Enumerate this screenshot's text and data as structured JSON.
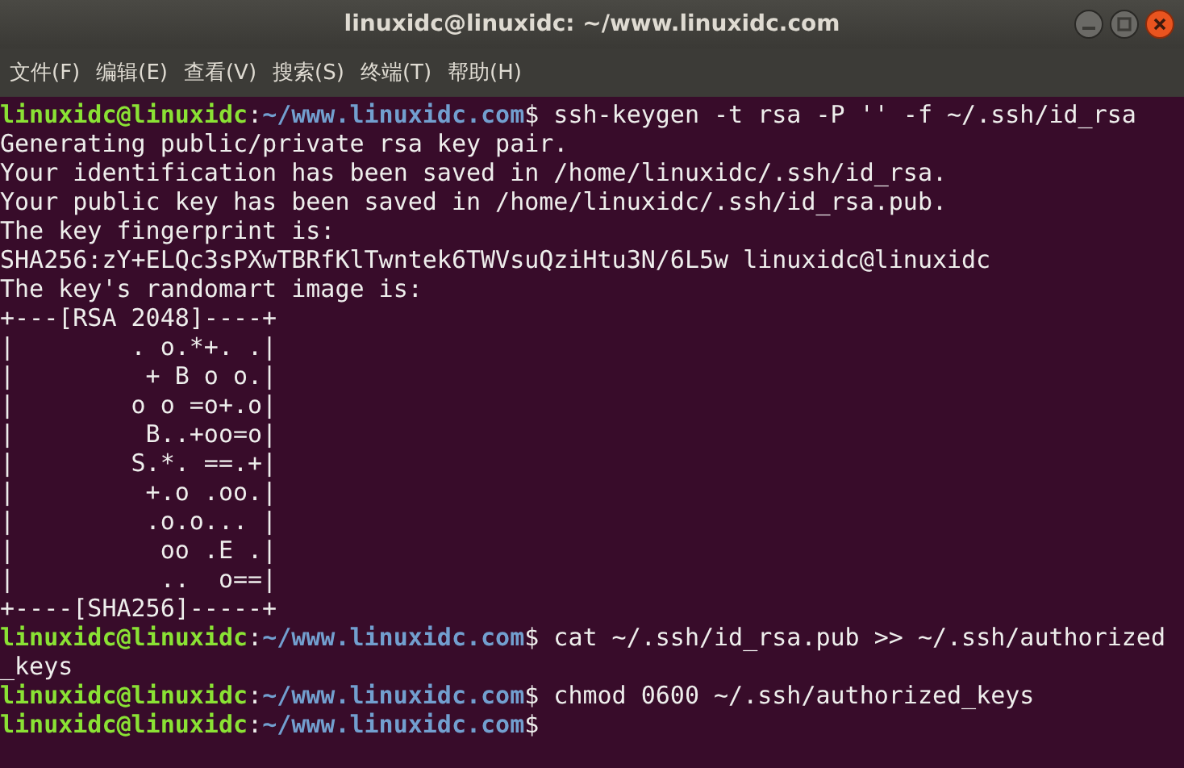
{
  "window": {
    "title": "linuxidc@linuxidc: ~/www.linuxidc.com"
  },
  "menu": [
    "文件(F)",
    "编辑(E)",
    "查看(V)",
    "搜索(S)",
    "终端(T)",
    "帮助(H)"
  ],
  "terminal": {
    "lines": [
      {
        "kind": "prompt",
        "user": "linuxidc@linuxidc",
        "separator": ":",
        "path": "~/www.linuxidc.com",
        "symbol": "$",
        "command": " ssh-keygen -t rsa -P '' -f ~/.ssh/id_rsa"
      },
      {
        "kind": "output",
        "text": "Generating public/private rsa key pair."
      },
      {
        "kind": "output",
        "text": "Your identification has been saved in /home/linuxidc/.ssh/id_rsa."
      },
      {
        "kind": "output",
        "text": "Your public key has been saved in /home/linuxidc/.ssh/id_rsa.pub."
      },
      {
        "kind": "output",
        "text": "The key fingerprint is:"
      },
      {
        "kind": "output",
        "text": "SHA256:zY+ELQc3sPXwTBRfKlTwntek6TWVsuQziHtu3N/6L5w linuxidc@linuxidc"
      },
      {
        "kind": "output",
        "text": "The key's randomart image is:"
      },
      {
        "kind": "output",
        "text": "+---[RSA 2048]----+"
      },
      {
        "kind": "output",
        "text": "|        . o.*+. .|"
      },
      {
        "kind": "output",
        "text": "|         + B o o.|"
      },
      {
        "kind": "output",
        "text": "|        o o =o+.o|"
      },
      {
        "kind": "output",
        "text": "|         B..+oo=o|"
      },
      {
        "kind": "output",
        "text": "|        S.*. ==.+|"
      },
      {
        "kind": "output",
        "text": "|         +.o .oo.|"
      },
      {
        "kind": "output",
        "text": "|         .o.o... |"
      },
      {
        "kind": "output",
        "text": "|          oo .E .|"
      },
      {
        "kind": "output",
        "text": "|          ..  o==|"
      },
      {
        "kind": "output",
        "text": "+----[SHA256]-----+"
      },
      {
        "kind": "prompt",
        "user": "linuxidc@linuxidc",
        "separator": ":",
        "path": "~/www.linuxidc.com",
        "symbol": "$",
        "command": " cat ~/.ssh/id_rsa.pub >> ~/.ssh/authorized"
      },
      {
        "kind": "output",
        "text": "_keys"
      },
      {
        "kind": "prompt",
        "user": "linuxidc@linuxidc",
        "separator": ":",
        "path": "~/www.linuxidc.com",
        "symbol": "$",
        "command": " chmod 0600 ~/.ssh/authorized_keys"
      },
      {
        "kind": "prompt",
        "user": "linuxidc@linuxidc",
        "separator": ":",
        "path": "~/www.linuxidc.com",
        "symbol": "$"
      }
    ]
  }
}
